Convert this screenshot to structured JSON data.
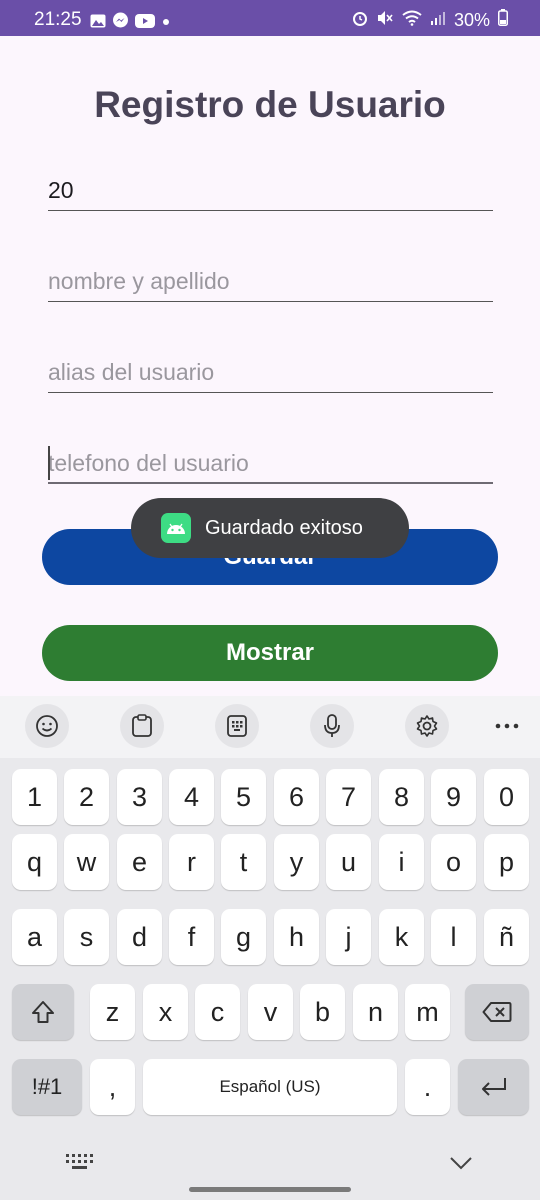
{
  "status_bar": {
    "time": "21:25",
    "battery": "30%",
    "icons_left": [
      "image-icon",
      "messenger-icon",
      "youtube-icon",
      "dot-icon"
    ],
    "icons_right": [
      "alarm-icon",
      "mute-icon",
      "wifi-icon",
      "signal-icon",
      "battery-icon"
    ]
  },
  "app": {
    "title": "Registro de Usuario",
    "fields": [
      {
        "value": "20",
        "placeholder": ""
      },
      {
        "value": "",
        "placeholder": "nombre y apellido"
      },
      {
        "value": "",
        "placeholder": "alias del usuario"
      },
      {
        "value": "",
        "placeholder": "telefono del usuario"
      }
    ],
    "buttons": {
      "guardar": "Guardar",
      "mostrar": "Mostrar"
    },
    "colors": {
      "guardar": "#0d47a1",
      "mostrar": "#2e7d32",
      "status_bar": "#6a4fa8"
    }
  },
  "toast": {
    "text": "Guardado exitoso",
    "icon": "android-icon"
  },
  "keyboard": {
    "toolbar": [
      "emoji-icon",
      "clipboard-icon",
      "keypad-icon",
      "mic-icon",
      "settings-icon",
      "more-icon"
    ],
    "rows": [
      [
        "1",
        "2",
        "3",
        "4",
        "5",
        "6",
        "7",
        "8",
        "9",
        "0"
      ],
      [
        "q",
        "w",
        "e",
        "r",
        "t",
        "y",
        "u",
        "i",
        "o",
        "p"
      ],
      [
        "a",
        "s",
        "d",
        "f",
        "g",
        "h",
        "j",
        "k",
        "l",
        "ñ"
      ],
      [
        "z",
        "x",
        "c",
        "v",
        "b",
        "n",
        "m"
      ]
    ],
    "symbols_key": "!#1",
    "comma_key": ",",
    "space_label": "Español (US)",
    "period_key": ".",
    "shift_icon": "shift-icon",
    "backspace_icon": "backspace-icon",
    "enter_icon": "enter-icon",
    "nav": [
      "keyboard-grid-icon",
      "chevron-down-icon"
    ]
  }
}
